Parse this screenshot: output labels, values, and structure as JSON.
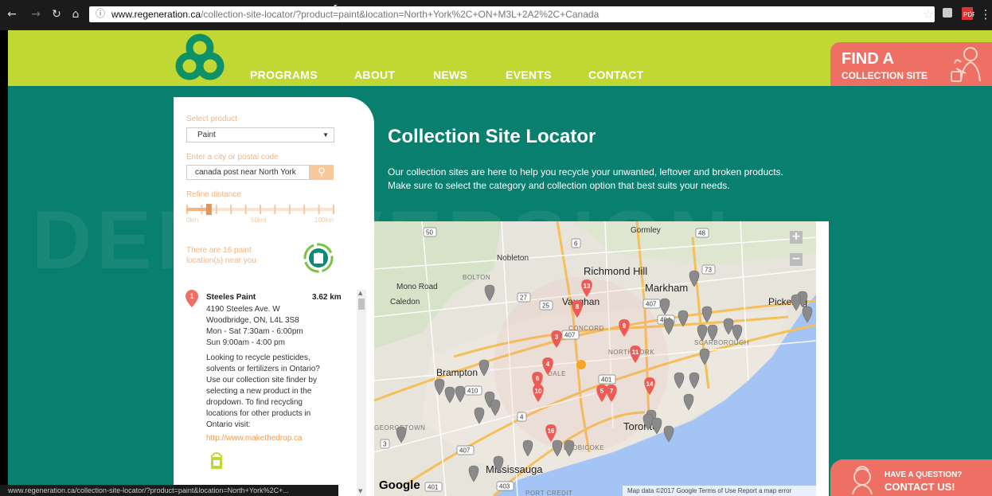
{
  "browser": {
    "url_host": "www.regeneration.ca",
    "url_path": "/collection-site-locator/?product=paint&location=North+York%2C+ON+M3L+2A2%2C+Canada",
    "status_url": "www.regeneration.ca/collection-site-locator/?product=paint&location=North+York%2C+..."
  },
  "header": {
    "menu": [
      "PROGRAMS",
      "ABOUT",
      "NEWS",
      "EVENTS",
      "CONTACT"
    ],
    "find_line1": "FIND A",
    "find_line2": "COLLECTION SITE"
  },
  "watermark": "DEMO VERSION",
  "sidebar": {
    "select_product_label": "Select product",
    "product_value": "Paint",
    "city_label": "Enter a city or postal code",
    "city_value": "canada post near North York",
    "refine_label": "Refine distance",
    "distance_level_percent": 15,
    "distance_ticks": [
      "0km",
      "50km",
      "100km"
    ],
    "count_line1": "There are 16 paint",
    "count_line2": "location(s) near you",
    "result": {
      "number": "1",
      "name": "Steeles Paint",
      "distance": "3.62 km",
      "address1": "4190 Steeles Ave. W",
      "address2": "Woodbridge, ON, L4L 3S8",
      "hours1": "Mon - Sat 7:30am - 6:00pm",
      "hours2": "Sun 9:00am - 4:00 pm",
      "note_lines": [
        "Looking to recycle pesticides,",
        "solvents or fertilizers in Ontario?",
        "Use our collection site finder by",
        "selecting a new product in the",
        "dropdown. To find recycling",
        "locations for other products in",
        "Ontario visit:"
      ],
      "link": "http://www.makethedrop.ca"
    }
  },
  "content": {
    "heading": "Collection Site Locator",
    "intro1": "Our collection sites are here to help you recycle your unwanted, leftover and broken products.",
    "intro2": "Make sure to select the category and collection option that best suits your needs."
  },
  "map": {
    "places": [
      {
        "name": "Richmond Hill",
        "cls": "big"
      },
      {
        "name": "Markham",
        "cls": "big"
      },
      {
        "name": "Vaughan",
        "cls": "mid"
      },
      {
        "name": "Brampton",
        "cls": "mid"
      },
      {
        "name": "Toronto",
        "cls": "big"
      },
      {
        "name": "Mississauga",
        "cls": "big"
      },
      {
        "name": "Pickering",
        "cls": "mid"
      },
      {
        "name": "Nobleton",
        "cls": ""
      },
      {
        "name": "Mono Road",
        "cls": ""
      },
      {
        "name": "Caledon",
        "cls": ""
      },
      {
        "name": "Gormley",
        "cls": ""
      },
      {
        "name": "BOLTON",
        "cls": "small"
      },
      {
        "name": "CONCORD",
        "cls": "small"
      },
      {
        "name": "NORTH YORK",
        "cls": "small"
      },
      {
        "name": "SCARBOROUGH",
        "cls": "small"
      },
      {
        "name": "ETOBICOKE",
        "cls": "small"
      },
      {
        "name": "GEORGETOWN",
        "cls": "small"
      },
      {
        "name": "PORT CREDIT",
        "cls": "small"
      },
      {
        "name": "DALE",
        "cls": "small"
      }
    ],
    "shields": [
      "50",
      "6",
      "48",
      "73",
      "27",
      "25",
      "407",
      "404",
      "407",
      "401",
      "410",
      "4",
      "407",
      "3",
      "401",
      "403"
    ],
    "zoom_in": "+",
    "zoom_out": "−",
    "google": "Google",
    "credits": "Map data ©2017 Google   Terms of Use   Report a map error",
    "red_pins": [
      "13",
      "8",
      "9",
      "3",
      "11",
      "4",
      "6",
      "10",
      "5",
      "7",
      "14",
      "16"
    ]
  },
  "question": {
    "line1": "HAVE A QUESTION?",
    "line2": "CONTACT US!"
  },
  "colors": {
    "lime": "#c1d834",
    "teal": "#087f6f",
    "coral": "#ee6f64",
    "orange_label": "#f6b37e"
  }
}
